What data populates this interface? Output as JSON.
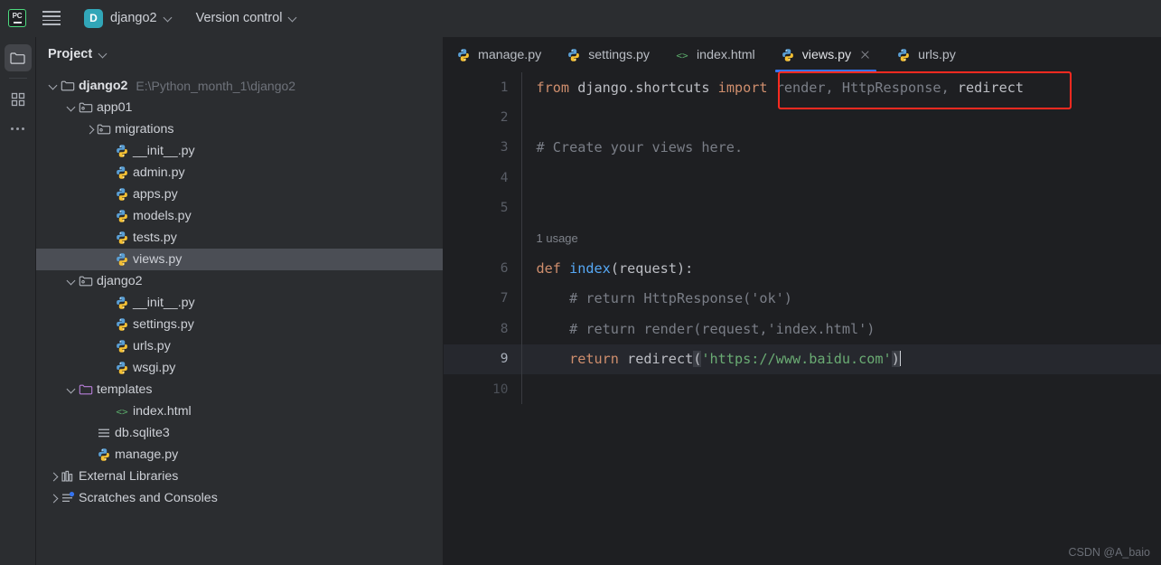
{
  "topbar": {
    "logo_text": "PC",
    "project_badge": "D",
    "project_name": "django2",
    "vcs_label": "Version control"
  },
  "rail": {
    "items": [
      {
        "name": "project-folder",
        "icon": "folder-icon",
        "active": true
      },
      {
        "name": "structure",
        "icon": "blocks-icon",
        "active": false
      },
      {
        "name": "more",
        "icon": "ellipsis-icon",
        "active": false
      }
    ]
  },
  "project_panel": {
    "title": "Project",
    "tree": [
      {
        "label": "django2",
        "path_hint": "E:\\Python_month_1\\django2",
        "icon": "folder-icon",
        "twisty": "down",
        "indent": 0,
        "bold": true,
        "selected": false
      },
      {
        "label": "app01",
        "path_hint": "",
        "icon": "module-folder-icon",
        "twisty": "down",
        "indent": 1,
        "bold": false,
        "selected": false
      },
      {
        "label": "migrations",
        "path_hint": "",
        "icon": "module-folder-icon",
        "twisty": "right",
        "indent": 2,
        "bold": false,
        "selected": false
      },
      {
        "label": "__init__.py",
        "path_hint": "",
        "icon": "python-file-icon",
        "twisty": "none",
        "indent": 3,
        "bold": false,
        "selected": false
      },
      {
        "label": "admin.py",
        "path_hint": "",
        "icon": "python-file-icon",
        "twisty": "none",
        "indent": 3,
        "bold": false,
        "selected": false
      },
      {
        "label": "apps.py",
        "path_hint": "",
        "icon": "python-file-icon",
        "twisty": "none",
        "indent": 3,
        "bold": false,
        "selected": false
      },
      {
        "label": "models.py",
        "path_hint": "",
        "icon": "python-file-icon",
        "twisty": "none",
        "indent": 3,
        "bold": false,
        "selected": false
      },
      {
        "label": "tests.py",
        "path_hint": "",
        "icon": "python-file-icon",
        "twisty": "none",
        "indent": 3,
        "bold": false,
        "selected": false
      },
      {
        "label": "views.py",
        "path_hint": "",
        "icon": "python-file-icon",
        "twisty": "none",
        "indent": 3,
        "bold": false,
        "selected": true
      },
      {
        "label": "django2",
        "path_hint": "",
        "icon": "module-folder-icon",
        "twisty": "down",
        "indent": 1,
        "bold": false,
        "selected": false
      },
      {
        "label": "__init__.py",
        "path_hint": "",
        "icon": "python-file-icon",
        "twisty": "none",
        "indent": 3,
        "bold": false,
        "selected": false
      },
      {
        "label": "settings.py",
        "path_hint": "",
        "icon": "python-file-icon",
        "twisty": "none",
        "indent": 3,
        "bold": false,
        "selected": false
      },
      {
        "label": "urls.py",
        "path_hint": "",
        "icon": "python-file-icon",
        "twisty": "none",
        "indent": 3,
        "bold": false,
        "selected": false
      },
      {
        "label": "wsgi.py",
        "path_hint": "",
        "icon": "python-file-icon",
        "twisty": "none",
        "indent": 3,
        "bold": false,
        "selected": false
      },
      {
        "label": "templates",
        "path_hint": "",
        "icon": "template-folder-icon",
        "twisty": "down",
        "indent": 1,
        "bold": false,
        "selected": false
      },
      {
        "label": "index.html",
        "path_hint": "",
        "icon": "html-file-icon",
        "twisty": "none",
        "indent": 3,
        "bold": false,
        "selected": false
      },
      {
        "label": "db.sqlite3",
        "path_hint": "",
        "icon": "db-file-icon",
        "twisty": "none",
        "indent": 2,
        "bold": false,
        "selected": false
      },
      {
        "label": "manage.py",
        "path_hint": "",
        "icon": "python-file-icon",
        "twisty": "none",
        "indent": 2,
        "bold": false,
        "selected": false
      },
      {
        "label": "External Libraries",
        "path_hint": "",
        "icon": "library-icon",
        "twisty": "right",
        "indent": 0,
        "bold": false,
        "selected": false
      },
      {
        "label": "Scratches and Consoles",
        "path_hint": "",
        "icon": "scratches-icon",
        "twisty": "right",
        "indent": 0,
        "bold": false,
        "selected": false
      }
    ]
  },
  "editor": {
    "tabs": [
      {
        "label": "manage.py",
        "icon": "python-file-icon",
        "active": false,
        "closable": false
      },
      {
        "label": "settings.py",
        "icon": "python-file-icon",
        "active": false,
        "closable": false
      },
      {
        "label": "index.html",
        "icon": "html-file-icon",
        "active": false,
        "closable": false
      },
      {
        "label": "views.py",
        "icon": "python-file-icon",
        "active": true,
        "closable": true
      },
      {
        "label": "urls.py",
        "icon": "python-file-icon",
        "active": false,
        "closable": false
      }
    ],
    "usage_hint": "1 usage",
    "lines": [
      {
        "num": "1",
        "current": false
      },
      {
        "num": "2",
        "current": false
      },
      {
        "num": "3",
        "current": false
      },
      {
        "num": "4",
        "current": false
      },
      {
        "num": "5",
        "current": false
      },
      {
        "num": "",
        "current": false
      },
      {
        "num": "6",
        "current": false
      },
      {
        "num": "7",
        "current": false
      },
      {
        "num": "8",
        "current": false
      },
      {
        "num": "9",
        "current": true
      },
      {
        "num": "10",
        "current": false
      }
    ],
    "code": {
      "l1_from": "from",
      "l1_module": " django.shortcuts ",
      "l1_import": "import",
      "l1_unused": " render, HttpResponse, ",
      "l1_used": "redirect",
      "l3_comment": "# Create your views here.",
      "l6_def": "def",
      "l6_name": " index",
      "l6_rest": "(request):",
      "l7_comment": "    # return HttpResponse('ok')",
      "l8_comment": "    # return render(request,'index.html')",
      "l9_return": "    return",
      "l9_call": " redirect",
      "l9_open": "(",
      "l9_str": "'https://www.baidu.com'",
      "l9_close": ")"
    }
  },
  "annotation": {
    "highlight_color": "#ff2a20",
    "accent_color": "#3574f0"
  },
  "watermark": "CSDN @A_baio"
}
